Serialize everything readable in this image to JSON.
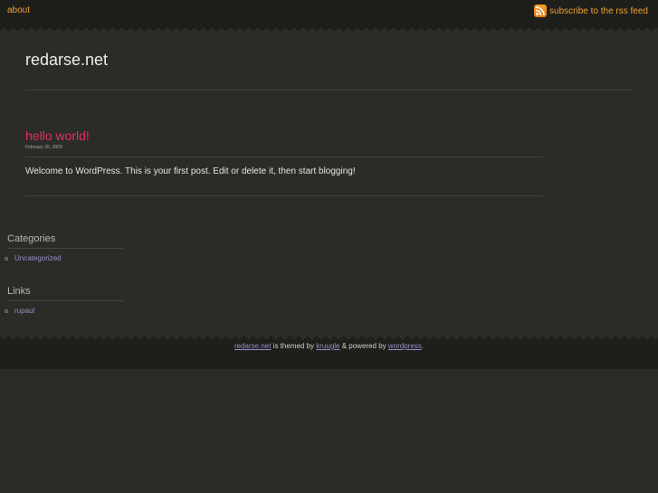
{
  "nav": {
    "about_label": "about",
    "rss_label": "subscribe to the rss feed",
    "rss_icon": "rss-feed-icon"
  },
  "header": {
    "site_title": "redarse.net"
  },
  "post": {
    "title": "hello world!",
    "date": "February 26, 2009",
    "body": "Welcome to WordPress. This is your first post. Edit or delete it, then start blogging!"
  },
  "sidebar": {
    "categories_title": "Categories",
    "categories": [
      "Uncategorized"
    ],
    "links_title": "Links",
    "links": [
      "rupaul"
    ]
  },
  "footer": {
    "site_link": "redarse.net",
    "text_themed": " is themed by ",
    "theme_link": "kruugle",
    "text_powered": " & powered by ",
    "wp_link": "wordpress",
    "text_end": "."
  },
  "colors": {
    "background": "#2b2b27",
    "bar": "#1e1e1b",
    "accent_orange": "#f0a030",
    "post_title": "#e0325a",
    "link_purple": "#9a8ec8"
  }
}
